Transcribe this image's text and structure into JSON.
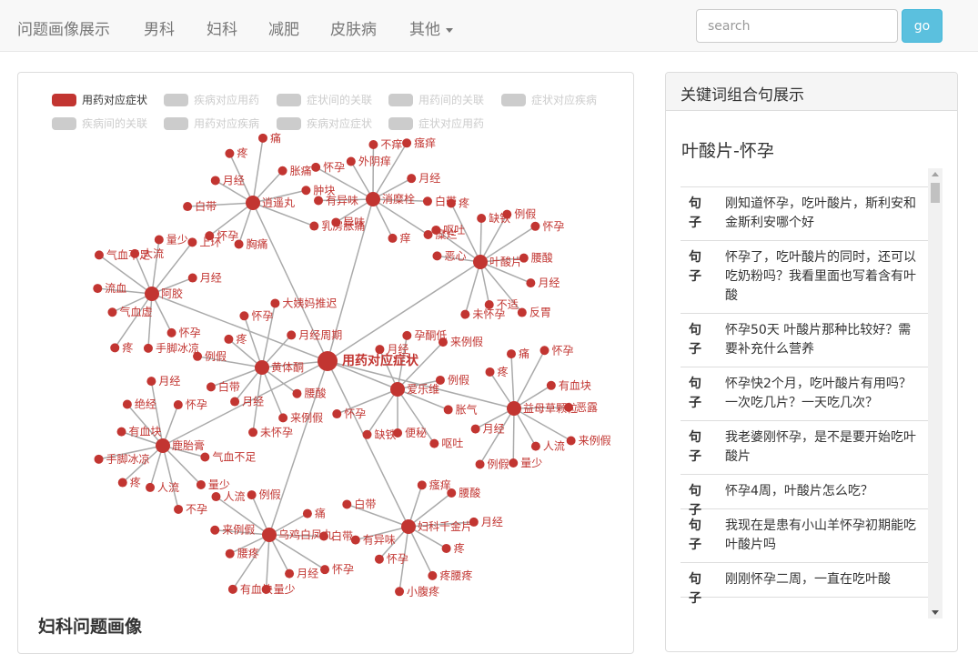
{
  "navbar": {
    "brand": "问题画像展示",
    "items": [
      {
        "label": "男科"
      },
      {
        "label": "妇科"
      },
      {
        "label": "减肥"
      },
      {
        "label": "皮肤病"
      },
      {
        "label": "其他"
      }
    ],
    "search_placeholder": "search",
    "go_label": "go"
  },
  "graph_panel": {
    "title": "妇科问题画像",
    "legend": [
      {
        "label": "用药对应症状",
        "active": true
      },
      {
        "label": "疾病对应用药",
        "active": false
      },
      {
        "label": "症状间的关联",
        "active": false
      },
      {
        "label": "用药间的关联",
        "active": false
      },
      {
        "label": "症状对应疾病",
        "active": false
      },
      {
        "label": "疾病间的关联",
        "active": false
      },
      {
        "label": "用药对应疾病",
        "active": false
      },
      {
        "label": "疾病对应症状",
        "active": false
      },
      {
        "label": "症状对应用药",
        "active": false
      }
    ],
    "colors": {
      "node": "#c23531",
      "link": "#aaaaaa",
      "inactive": "#cccccc"
    },
    "root": "用药对应症状",
    "clusters": [
      {
        "name": "逍遥丸",
        "items": [
          "胸痛",
          "怀孕",
          "白带",
          "月经",
          "疼",
          "痛",
          "胀痛",
          "肿块",
          "乳房胀痛"
        ]
      },
      {
        "name": "消糜栓",
        "items": [
          "异味",
          "有异味",
          "怀孕",
          "外阴痒",
          "不痒",
          "瘙痒",
          "月经",
          "白带",
          "糜烂",
          "痒"
        ]
      },
      {
        "name": "叶酸片",
        "items": [
          "恶心",
          "呕吐",
          "疼",
          "缺铁",
          "例假",
          "怀孕",
          "腰酸",
          "月经",
          "反胃",
          "不适",
          "未怀孕"
        ]
      },
      {
        "name": "阿胶",
        "items": [
          "怀孕",
          "手脚冰凉",
          "疼",
          "气血虚",
          "流血",
          "气血不足",
          "大流",
          "量少",
          "上环",
          "月经"
        ]
      },
      {
        "name": "益母草颗粒",
        "items": [
          "疼",
          "痛",
          "怀孕",
          "有血块",
          "恶露",
          "来例假",
          "人流",
          "量少",
          "例假",
          "月经"
        ]
      },
      {
        "name": "鹿胎膏",
        "items": [
          "气血不足",
          "量少",
          "不孕",
          "人流",
          "疼",
          "手脚冰凉",
          "有血块",
          "绝经",
          "月经",
          "怀孕"
        ]
      },
      {
        "name": "乌鸡白凤丸",
        "items": [
          "痛",
          "白带",
          "怀孕",
          "月经",
          "量少",
          "有血块",
          "腰疼",
          "来例假",
          "人流",
          "例假"
        ]
      },
      {
        "name": "妇科千金片",
        "items": [
          "瘙痒",
          "腰酸",
          "月经",
          "疼",
          "疼腰疼",
          "小腹疼",
          "怀孕",
          "有异味",
          "白带"
        ]
      },
      {
        "name": "爱乐维",
        "items": [
          "月经",
          "孕酮低",
          "来例假",
          "例假",
          "胀气",
          "呕吐",
          "便秘",
          "缺铁",
          "怀孕"
        ]
      },
      {
        "name": "黄体酮",
        "items": [
          "腰酸",
          "来例假",
          "未怀孕",
          "月经",
          "白带",
          "例假",
          "疼",
          "怀孕",
          "大姨妈推迟",
          "月经周期"
        ]
      }
    ]
  },
  "right_panel": {
    "heading": "关键词组合句展示",
    "subtitle": "叶酸片-怀孕",
    "row_tag": "句子",
    "sentences": [
      "刚知道怀孕，吃叶酸片，斯利安和金斯利安哪个好",
      "怀孕了，吃叶酸片的同时，还可以吃奶粉吗？我看里面也写着含有叶酸",
      "怀孕50天 叶酸片那种比较好？需要补充什么营养",
      "怀孕快2个月，吃叶酸片有用吗？一次吃几片？一天吃几次？",
      "我老婆刚怀孕，是不是要开始吃叶酸片",
      "怀孕4周，叶酸片怎么吃？",
      "我现在是患有小山羊怀孕初期能吃叶酸片吗",
      "刚刚怀孕二周，一直在吃叶酸"
    ]
  }
}
